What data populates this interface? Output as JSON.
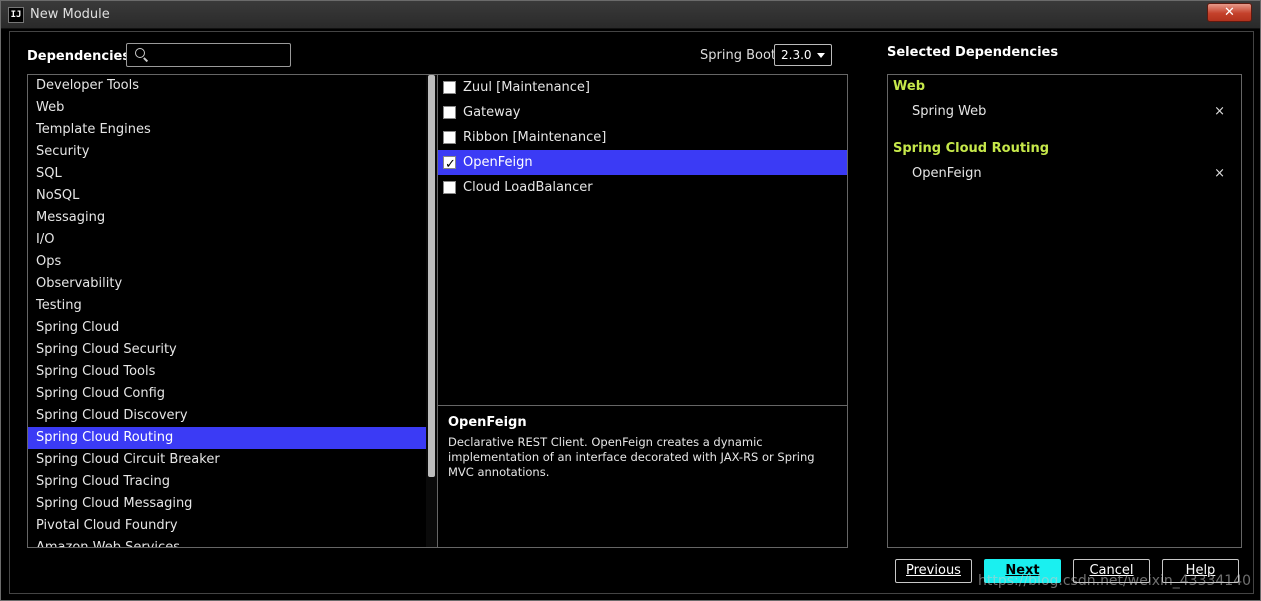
{
  "window": {
    "title": "New Module",
    "app_icon_text": "IJ",
    "close_glyph": "✕"
  },
  "header": {
    "dependencies_label": "Dependencies",
    "search": {
      "value": "",
      "placeholder": ""
    },
    "spring_boot_label": "Spring Boot",
    "spring_boot_version": "2.3.0"
  },
  "categories": [
    "Developer Tools",
    "Web",
    "Template Engines",
    "Security",
    "SQL",
    "NoSQL",
    "Messaging",
    "I/O",
    "Ops",
    "Observability",
    "Testing",
    "Spring Cloud",
    "Spring Cloud Security",
    "Spring Cloud Tools",
    "Spring Cloud Config",
    "Spring Cloud Discovery",
    "Spring Cloud Routing",
    "Spring Cloud Circuit Breaker",
    "Spring Cloud Tracing",
    "Spring Cloud Messaging",
    "Pivotal Cloud Foundry",
    "Amazon Web Services"
  ],
  "selected_category_index": 16,
  "dependencies": [
    {
      "label": "Zuul [Maintenance]",
      "checked": false
    },
    {
      "label": "Gateway",
      "checked": false
    },
    {
      "label": "Ribbon [Maintenance]",
      "checked": false
    },
    {
      "label": "OpenFeign",
      "checked": true
    },
    {
      "label": "Cloud LoadBalancer",
      "checked": false
    }
  ],
  "selected_dependency_index": 3,
  "description": {
    "title": "OpenFeign",
    "text": "Declarative REST Client. OpenFeign creates a dynamic implementation of an interface decorated with JAX-RS or Spring MVC annotations."
  },
  "selected_panel": {
    "title": "Selected Dependencies",
    "groups": [
      {
        "name": "Web",
        "items": [
          "Spring Web"
        ]
      },
      {
        "name": "Spring Cloud Routing",
        "items": [
          "OpenFeign"
        ]
      }
    ],
    "remove_glyph": "×"
  },
  "buttons": {
    "previous": "Previous",
    "next": "Next",
    "cancel": "Cancel",
    "help": "Help"
  },
  "watermark": "https://blog.csdn.net/weixin_43334140",
  "colors": {
    "selection": "#3b3bf5",
    "group_title": "#c6e84a",
    "primary_button": "#1af0f0"
  }
}
